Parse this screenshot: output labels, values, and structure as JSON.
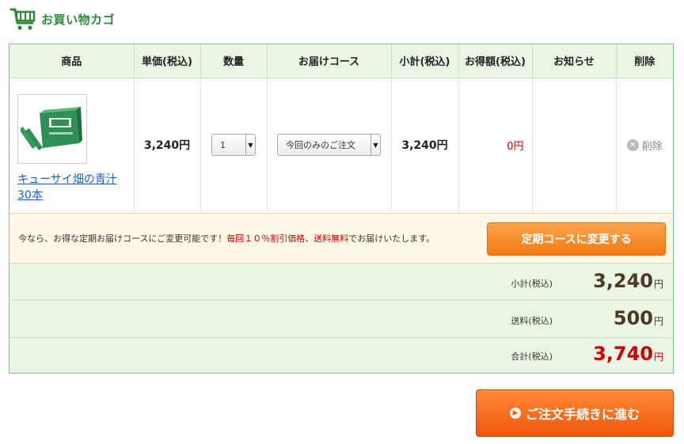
{
  "header": {
    "title": "お買い物カゴ",
    "icon": "cart-icon",
    "accent": "#2e8b3a"
  },
  "table": {
    "columns": [
      "商品",
      "単価(税込)",
      "数量",
      "お届けコース",
      "小計(税込)",
      "お得額(税込)",
      "お知らせ",
      "削除"
    ],
    "item": {
      "name_line1": "キューサイ畑の青汁",
      "name_line2": "30本",
      "unit_price": "3,240円",
      "quantity": "1",
      "course": "今回のみのご注文",
      "subtotal": "3,240円",
      "discount": "0円",
      "notice": "",
      "delete_label": "削除"
    }
  },
  "promo": {
    "text_before": "今なら、お得な定期お届けコースにご変更可能です！",
    "text_red1": "毎回１０％割引価格",
    "text_sep": "、",
    "text_red2": "送料無料",
    "text_after": "でお届けいたします。",
    "button_label": "定期コースに変更する"
  },
  "summary": {
    "subtotal_label": "小計(税込)",
    "subtotal_value": "3,240",
    "shipping_label": "送料(税込)",
    "shipping_value": "500",
    "total_label": "合計(税込)",
    "total_value": "3,740",
    "yen": "円"
  },
  "order_button_label": "ご注文手続きに進む",
  "colors": {
    "promo_button": "#f07a14",
    "order_button": "#f0560a",
    "total": "#cc0000",
    "link": "#1a5fc8"
  }
}
